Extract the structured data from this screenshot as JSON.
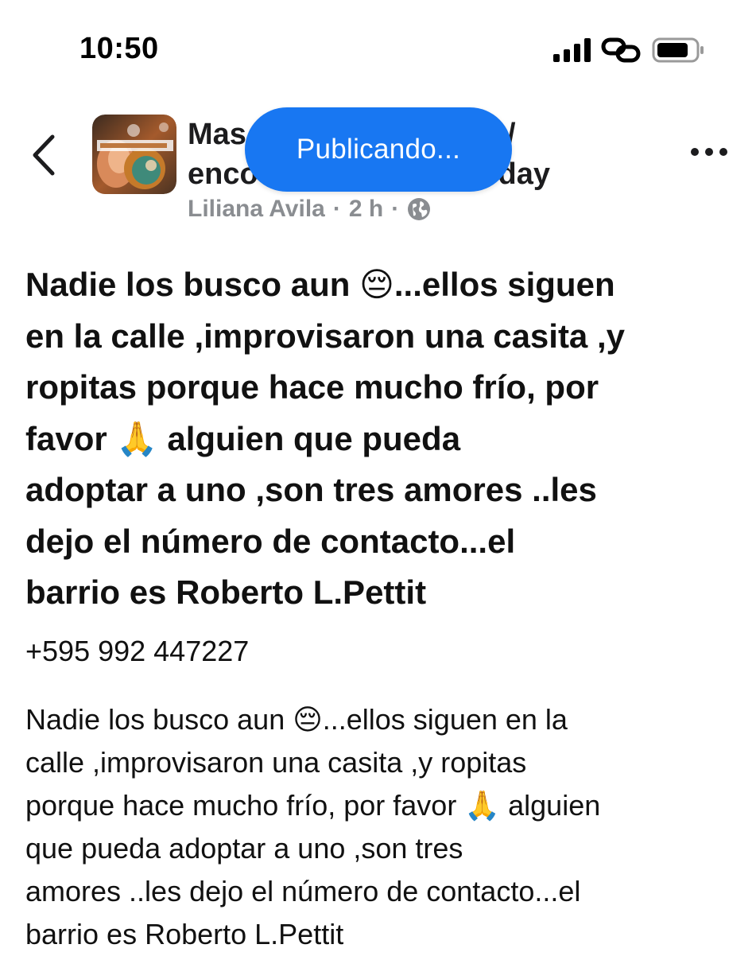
{
  "status_bar": {
    "time": "10:50",
    "icons": [
      "cellular-signal-icon",
      "link-icon",
      "battery-icon"
    ]
  },
  "header": {
    "group_name_line1_start": "Mas",
    "group_name_line1_end": "/",
    "group_name_line2_start": "enco",
    "group_name_line2_end": "day",
    "author": "Liliana Avila",
    "separator": "·",
    "time_ago": "2 h",
    "privacy_icon": "globe-icon",
    "back_icon": "chevron-left-icon",
    "more_icon": "more-horizontal-icon"
  },
  "publishing_pill": {
    "label": "Publicando..."
  },
  "post": {
    "title_lines": [
      "Nadie los busco aun 😔...ellos siguen",
      "en la calle ,improvisaron una casita ,y",
      "ropitas porque hace mucho frío, por",
      "favor 🙏 alguien    que pueda",
      "adoptar a uno ,son  tres amores ..les",
      "dejo el número de contacto...el",
      "barrio es Roberto L.Pettit"
    ],
    "phone": "+595 992 447227",
    "body_lines": [
      "Nadie los busco aun 😔...ellos siguen en la",
      "calle ,improvisaron una casita ,y ropitas",
      "porque hace mucho frío, por favor 🙏 alguien",
      "que pueda adoptar a uno ,son  tres",
      "amores ..les dejo el número de contacto...el",
      "barrio es Roberto L.Pettit"
    ]
  },
  "colors": {
    "accent": "#1877f2",
    "meta_text": "#8a8d91",
    "text": "#111111"
  }
}
